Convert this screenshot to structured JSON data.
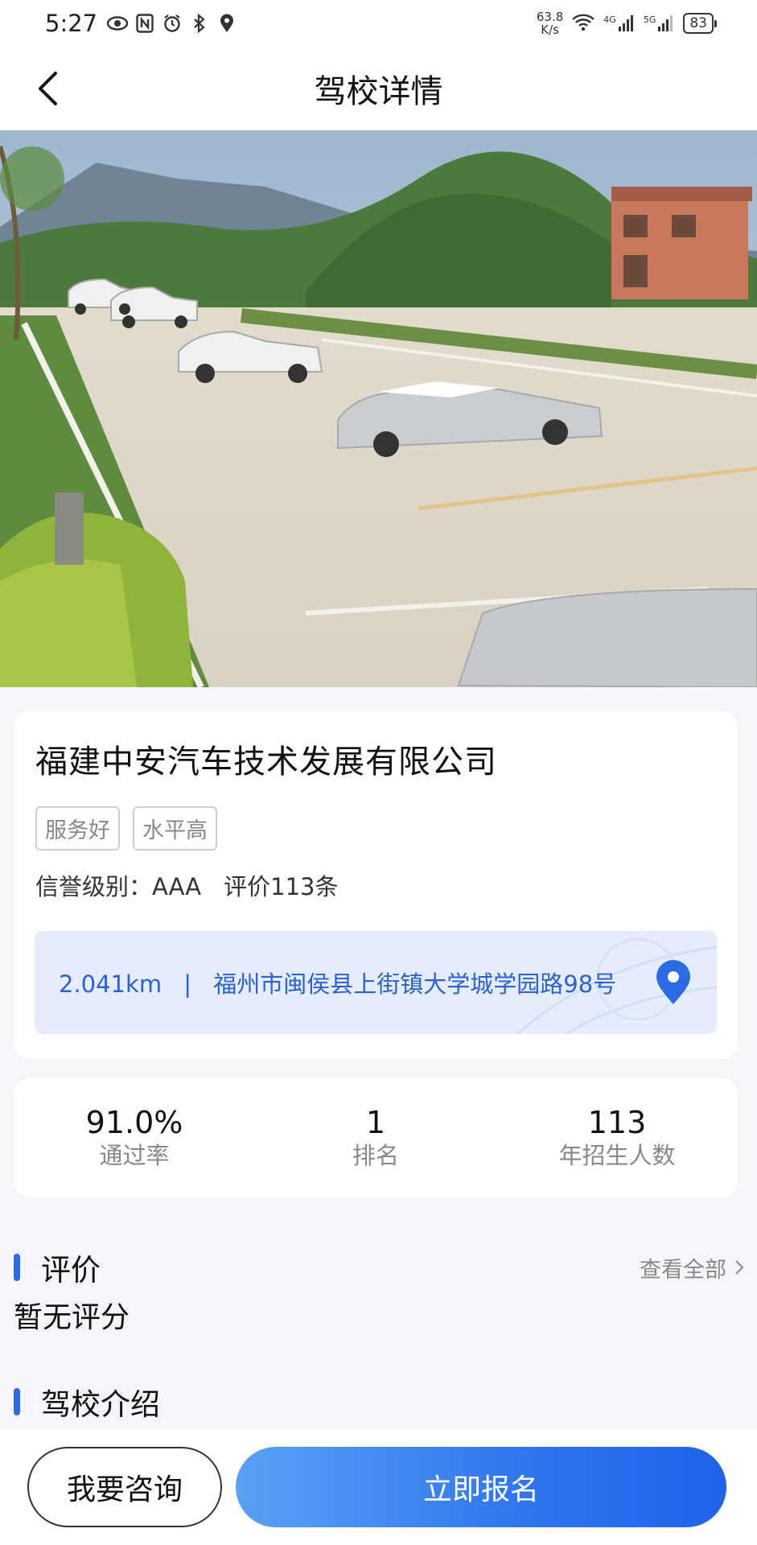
{
  "status_bar": {
    "time": "5:27",
    "net_speed_value": "63.8",
    "net_speed_unit": "K/s",
    "signal_1_label": "4G",
    "signal_2_label": "5G",
    "battery": "83",
    "icons": [
      "eye-icon",
      "nfc-icon",
      "alarm-icon",
      "bluetooth-icon",
      "location-icon",
      "wifi-icon",
      "signal-icon",
      "battery-icon"
    ]
  },
  "nav": {
    "title": "驾校详情"
  },
  "school": {
    "name": "福建中安汽车技术发展有限公司",
    "tags": [
      "服务好",
      "水平高"
    ],
    "credit_label": "信誉级别：AAA",
    "review_count_label": "评价113条",
    "distance": "2.041km",
    "separator": "|",
    "address": "福州市闽侯县上街镇大学城学园路98号"
  },
  "stats": [
    {
      "value": "91.0%",
      "label": "通过率"
    },
    {
      "value": "1",
      "label": "排名"
    },
    {
      "value": "113",
      "label": "年招生人数"
    }
  ],
  "reviews": {
    "title": "评价",
    "view_all": "查看全部",
    "empty_text": "暂无评分"
  },
  "intro": {
    "title": "驾校介绍"
  },
  "actions": {
    "consult": "我要咨询",
    "signup": "立即报名"
  },
  "colors": {
    "accent": "#2b6be6",
    "address_bg": "#e5edfc",
    "address_text": "#2b61d8"
  }
}
